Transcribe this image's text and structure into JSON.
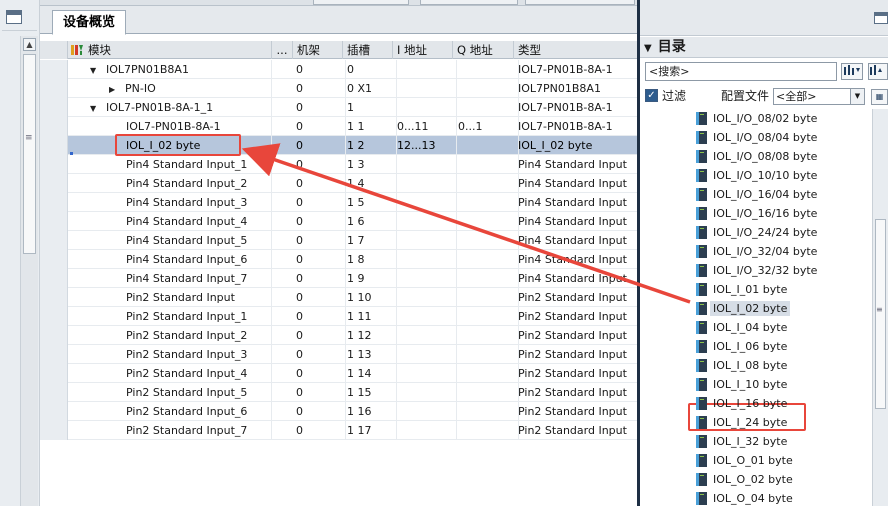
{
  "overview": {
    "tab_label": "设备概览",
    "columns": [
      "模块",
      "...",
      "机架",
      "插槽",
      "I 地址",
      "Q 地址",
      "类型"
    ],
    "rows": [
      {
        "name": "IOL7PN01B8A1",
        "tree": "expanded",
        "rack": "0",
        "slot": "0",
        "i_addr": "",
        "q_addr": "",
        "type": "IOL7-PN01B-8A-1"
      },
      {
        "name": "PN-IO",
        "tree": "collapsed",
        "rack": "0",
        "slot": "0 X1",
        "i_addr": "",
        "q_addr": "",
        "type": "IOL7PN01B8A1"
      },
      {
        "name": "IOL7-PN01B-8A-1_1",
        "tree": "expanded",
        "rack": "0",
        "slot": "1",
        "i_addr": "",
        "q_addr": "",
        "type": "IOL7-PN01B-8A-1"
      },
      {
        "name": "IOL7-PN01B-8A-1",
        "tree": "",
        "rack": "0",
        "slot": "1 1",
        "i_addr": "0...11",
        "q_addr": "0...1",
        "type": "IOL7-PN01B-8A-1"
      },
      {
        "name": "IOL_I_02 byte",
        "tree": "",
        "rack": "0",
        "slot": "1 2",
        "i_addr": "12...13",
        "q_addr": "",
        "type": "IOL_I_02 byte",
        "selected": true
      },
      {
        "name": "Pin4 Standard Input_1",
        "tree": "",
        "rack": "0",
        "slot": "1 3",
        "i_addr": "",
        "q_addr": "",
        "type": "Pin4 Standard Input"
      },
      {
        "name": "Pin4 Standard Input_2",
        "tree": "",
        "rack": "0",
        "slot": "1 4",
        "i_addr": "",
        "q_addr": "",
        "type": "Pin4 Standard Input"
      },
      {
        "name": "Pin4 Standard Input_3",
        "tree": "",
        "rack": "0",
        "slot": "1 5",
        "i_addr": "",
        "q_addr": "",
        "type": "Pin4 Standard Input"
      },
      {
        "name": "Pin4 Standard Input_4",
        "tree": "",
        "rack": "0",
        "slot": "1 6",
        "i_addr": "",
        "q_addr": "",
        "type": "Pin4 Standard Input"
      },
      {
        "name": "Pin4 Standard Input_5",
        "tree": "",
        "rack": "0",
        "slot": "1 7",
        "i_addr": "",
        "q_addr": "",
        "type": "Pin4 Standard Input"
      },
      {
        "name": "Pin4 Standard Input_6",
        "tree": "",
        "rack": "0",
        "slot": "1 8",
        "i_addr": "",
        "q_addr": "",
        "type": "Pin4 Standard Input"
      },
      {
        "name": "Pin4 Standard Input_7",
        "tree": "",
        "rack": "0",
        "slot": "1 9",
        "i_addr": "",
        "q_addr": "",
        "type": "Pin4 Standard Input"
      },
      {
        "name": "Pin2 Standard Input",
        "tree": "",
        "rack": "0",
        "slot": "1 10",
        "i_addr": "",
        "q_addr": "",
        "type": "Pin2 Standard Input"
      },
      {
        "name": "Pin2 Standard Input_1",
        "tree": "",
        "rack": "0",
        "slot": "1 11",
        "i_addr": "",
        "q_addr": "",
        "type": "Pin2 Standard Input"
      },
      {
        "name": "Pin2 Standard Input_2",
        "tree": "",
        "rack": "0",
        "slot": "1 12",
        "i_addr": "",
        "q_addr": "",
        "type": "Pin2 Standard Input"
      },
      {
        "name": "Pin2 Standard Input_3",
        "tree": "",
        "rack": "0",
        "slot": "1 13",
        "i_addr": "",
        "q_addr": "",
        "type": "Pin2 Standard Input"
      },
      {
        "name": "Pin2 Standard Input_4",
        "tree": "",
        "rack": "0",
        "slot": "1 14",
        "i_addr": "",
        "q_addr": "",
        "type": "Pin2 Standard Input"
      },
      {
        "name": "Pin2 Standard Input_5",
        "tree": "",
        "rack": "0",
        "slot": "1 15",
        "i_addr": "",
        "q_addr": "",
        "type": "Pin2 Standard Input"
      },
      {
        "name": "Pin2 Standard Input_6",
        "tree": "",
        "rack": "0",
        "slot": "1 16",
        "i_addr": "",
        "q_addr": "",
        "type": "Pin2 Standard Input"
      },
      {
        "name": "Pin2 Standard Input_7",
        "tree": "",
        "rack": "0",
        "slot": "1 17",
        "i_addr": "",
        "q_addr": "",
        "type": "Pin2 Standard Input"
      }
    ]
  },
  "catalog": {
    "title": "目录",
    "search_placeholder": "<搜索>",
    "filter_label": "过滤",
    "filter_checked": true,
    "profile_label": "配置文件",
    "profile_value": "<全部>",
    "items": [
      {
        "label": "IOL_I/O_08/02 byte"
      },
      {
        "label": "IOL_I/O_08/04 byte"
      },
      {
        "label": "IOL_I/O_08/08 byte"
      },
      {
        "label": "IOL_I/O_10/10 byte"
      },
      {
        "label": "IOL_I/O_16/04 byte"
      },
      {
        "label": "IOL_I/O_16/16 byte"
      },
      {
        "label": "IOL_I/O_24/24 byte"
      },
      {
        "label": "IOL_I/O_32/04 byte"
      },
      {
        "label": "IOL_I/O_32/32 byte"
      },
      {
        "label": "IOL_I_01 byte"
      },
      {
        "label": "IOL_I_02 byte",
        "selected": true
      },
      {
        "label": "IOL_I_04 byte"
      },
      {
        "label": "IOL_I_06 byte"
      },
      {
        "label": "IOL_I_08 byte"
      },
      {
        "label": "IOL_I_10 byte"
      },
      {
        "label": "IOL_I_16 byte"
      },
      {
        "label": "IOL_I_24 byte"
      },
      {
        "label": "IOL_I_32 byte"
      },
      {
        "label": "IOL_O_01 byte"
      },
      {
        "label": "IOL_O_02 byte"
      },
      {
        "label": "IOL_O_04 byte"
      }
    ]
  },
  "colors": {
    "highlight": "#e8463b",
    "selected_row": "#b6c6dc",
    "divider": "#1e2f44"
  }
}
